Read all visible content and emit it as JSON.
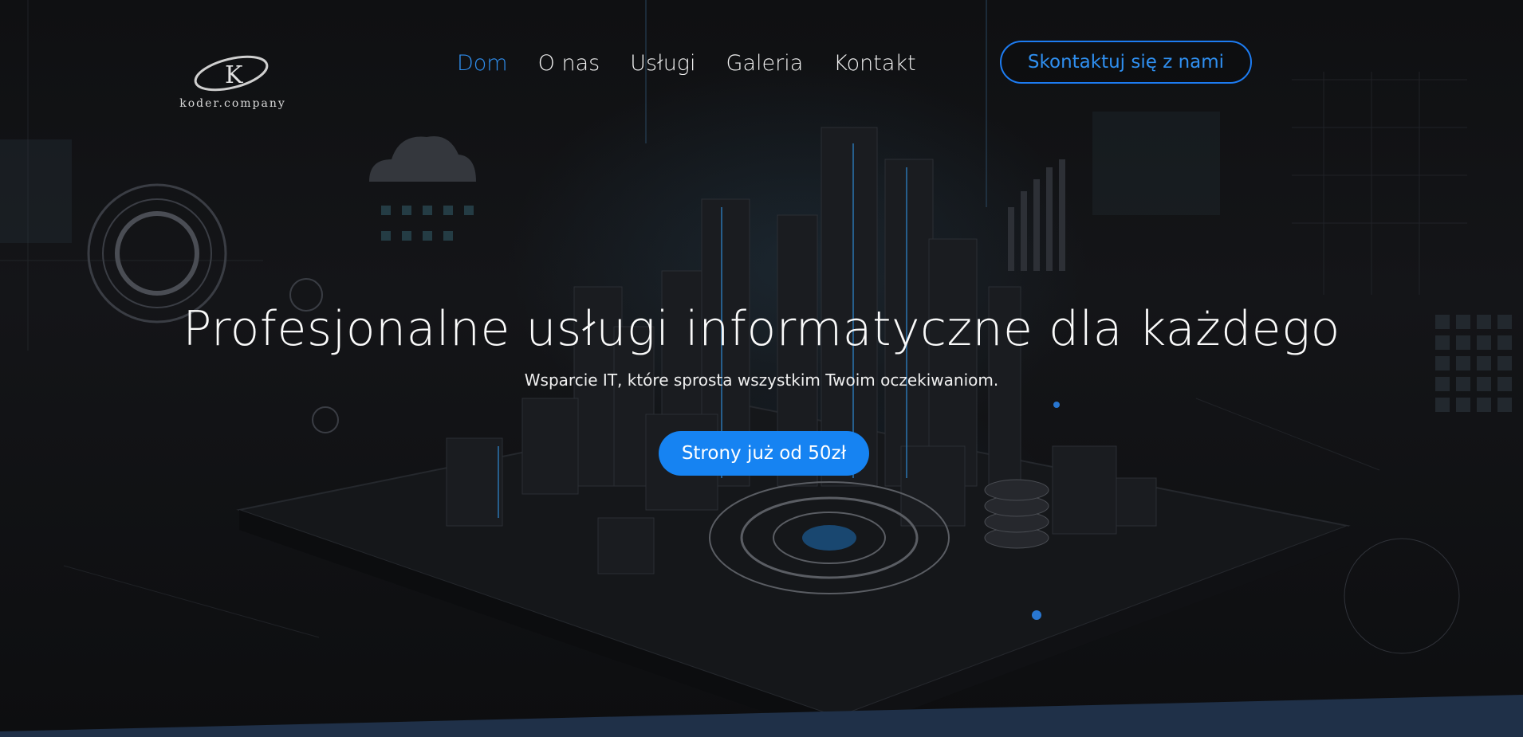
{
  "brand": {
    "logo_text": "koder.company",
    "logo_letter": "K",
    "icon": "k-swoosh-logo-icon"
  },
  "nav": {
    "items": [
      {
        "label": "Dom",
        "active": true
      },
      {
        "label": "O nas",
        "active": false
      },
      {
        "label": "Usługi",
        "active": false
      },
      {
        "label": "Galeria",
        "active": false
      },
      {
        "label": "Kontakt",
        "active": false
      }
    ],
    "contact_button": "Skontaktuj się z nami"
  },
  "hero": {
    "headline": "Profesjonalne usługi informatyczne dla każdego",
    "subline": "Wsparcie IT, które sprosta wszystkim Twoim oczekiwaniom.",
    "cta": "Strony już od 50zł"
  },
  "colors": {
    "accent": "#1683f2",
    "accent_text": "#2f8ff0",
    "background": "#0f1012",
    "band": "#1f3048"
  }
}
